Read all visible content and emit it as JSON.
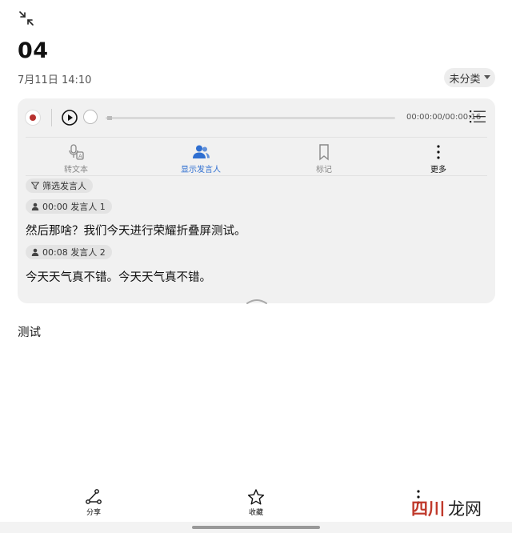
{
  "header": {
    "title": "04",
    "date": "7月11日 14:10",
    "category": "未分类"
  },
  "player": {
    "time": "00:00:00/00:00:16"
  },
  "toolbar": {
    "transcribe_label": "转文本",
    "show_speaker_label": "显示发言人",
    "mark_label": "标记",
    "more_label": "更多"
  },
  "transcript": {
    "filter_label": "筛选发言人",
    "entries": [
      {
        "speaker": "00:00 发言人 1",
        "text": "然后那啥？我们今天进行荣耀折叠屏测试。"
      },
      {
        "speaker": "00:08 发言人 2",
        "text": "今天天气真不错。今天天气真不错。"
      }
    ]
  },
  "note_body": "测试",
  "bottom_bar": {
    "share_label": "分享",
    "favorite_label": "收藏"
  },
  "watermark_text": "四川龙网",
  "colors": {
    "accent": "#2f6fd1",
    "record": "#b8322f",
    "card_bg": "#f1f1f1",
    "watermark": "#c0392b"
  }
}
